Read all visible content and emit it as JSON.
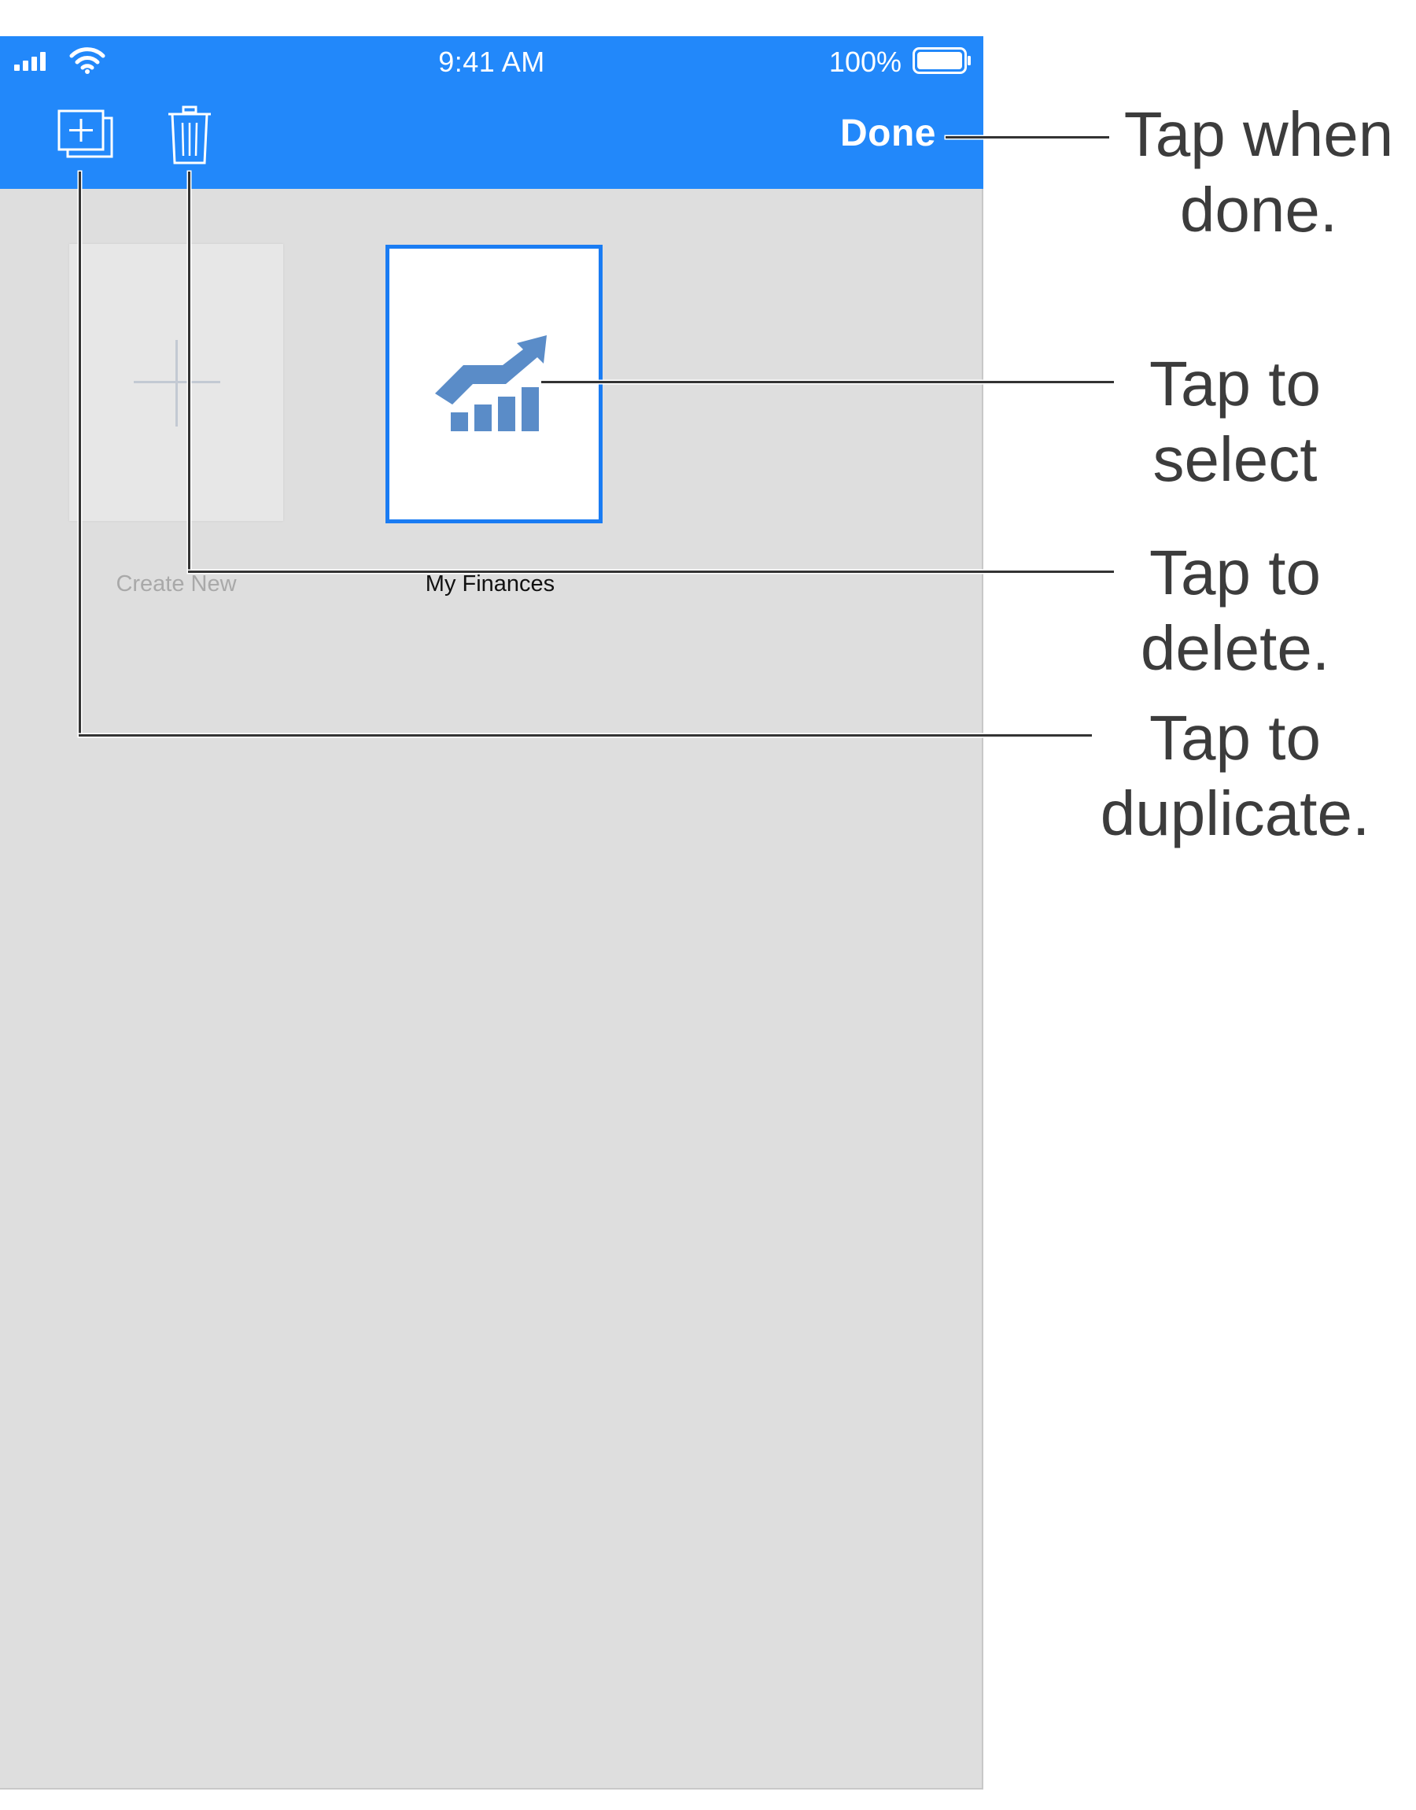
{
  "status_bar": {
    "time": "9:41 AM",
    "battery_percent": "100%"
  },
  "toolbar": {
    "duplicate_icon": "duplicate-icon",
    "trash_icon": "trash-icon",
    "done_label": "Done"
  },
  "documents": [
    {
      "label": "Create New",
      "icon": "plus-icon"
    },
    {
      "label": "My Finances",
      "icon": "finance-chart-icon",
      "selected": true
    }
  ],
  "callouts": {
    "done": [
      "Tap when",
      "done."
    ],
    "select": [
      "Tap to",
      "select"
    ],
    "delete": [
      "Tap to",
      "delete."
    ],
    "duplicate": [
      "Tap to",
      "duplicate."
    ]
  },
  "colors": {
    "accent": "#2288fa",
    "selection": "#1a7cf3",
    "background": "#dedede",
    "chart_icon": "#5a8cc8",
    "callout_text": "#3c3c3c"
  }
}
